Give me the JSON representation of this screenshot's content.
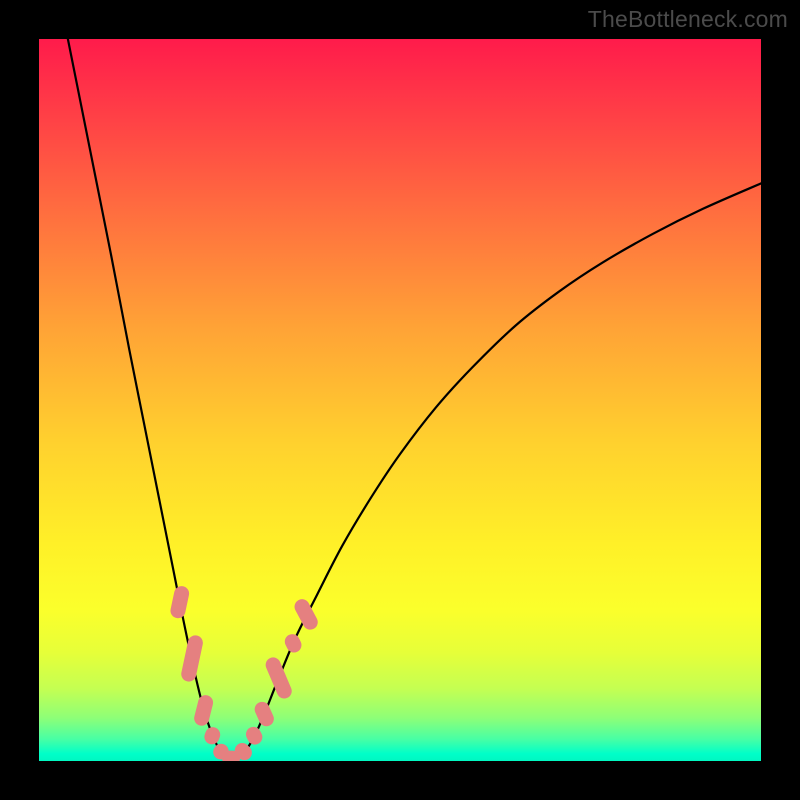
{
  "watermark": "TheBottleneck.com",
  "colors": {
    "frame": "#000000",
    "curve_stroke": "#000000",
    "bead_fill": "#e58080",
    "bead_stroke": "#d46a6a",
    "gradient_stops": [
      {
        "pct": 0,
        "hex": "#ff1b4b"
      },
      {
        "pct": 9,
        "hex": "#ff3a47"
      },
      {
        "pct": 24,
        "hex": "#ff6e3f"
      },
      {
        "pct": 40,
        "hex": "#ffa336"
      },
      {
        "pct": 56,
        "hex": "#ffd12e"
      },
      {
        "pct": 70,
        "hex": "#fff028"
      },
      {
        "pct": 79,
        "hex": "#fbff2b"
      },
      {
        "pct": 85,
        "hex": "#e6ff39"
      },
      {
        "pct": 90,
        "hex": "#c4ff52"
      },
      {
        "pct": 94,
        "hex": "#8eff77"
      },
      {
        "pct": 97,
        "hex": "#47ffa5"
      },
      {
        "pct": 99,
        "hex": "#00ffc9"
      },
      {
        "pct": 100,
        "hex": "#00f7c1"
      }
    ]
  },
  "chart_data": {
    "type": "line",
    "title": "",
    "xlabel": "",
    "ylabel": "",
    "xlim": [
      0,
      100
    ],
    "ylim": [
      0,
      100
    ],
    "curve_points": [
      {
        "x": 4.0,
        "y": 100.0
      },
      {
        "x": 6.0,
        "y": 90.0
      },
      {
        "x": 8.0,
        "y": 80.0
      },
      {
        "x": 10.0,
        "y": 70.0
      },
      {
        "x": 12.5,
        "y": 57.0
      },
      {
        "x": 14.5,
        "y": 47.0
      },
      {
        "x": 16.5,
        "y": 37.0
      },
      {
        "x": 18.5,
        "y": 27.0
      },
      {
        "x": 20.0,
        "y": 19.5
      },
      {
        "x": 21.5,
        "y": 12.5
      },
      {
        "x": 23.0,
        "y": 6.5
      },
      {
        "x": 24.5,
        "y": 2.5
      },
      {
        "x": 25.5,
        "y": 0.8
      },
      {
        "x": 26.5,
        "y": 0.3
      },
      {
        "x": 28.0,
        "y": 0.8
      },
      {
        "x": 29.5,
        "y": 2.8
      },
      {
        "x": 31.0,
        "y": 6.0
      },
      {
        "x": 33.0,
        "y": 11.0
      },
      {
        "x": 35.5,
        "y": 17.0
      },
      {
        "x": 38.5,
        "y": 23.0
      },
      {
        "x": 42.0,
        "y": 29.8
      },
      {
        "x": 46.0,
        "y": 36.5
      },
      {
        "x": 50.0,
        "y": 42.5
      },
      {
        "x": 55.0,
        "y": 49.0
      },
      {
        "x": 60.0,
        "y": 54.5
      },
      {
        "x": 66.0,
        "y": 60.3
      },
      {
        "x": 72.0,
        "y": 65.0
      },
      {
        "x": 78.0,
        "y": 69.0
      },
      {
        "x": 85.0,
        "y": 73.0
      },
      {
        "x": 92.0,
        "y": 76.5
      },
      {
        "x": 100.0,
        "y": 80.0
      }
    ],
    "beads_left": [
      {
        "x": 19.5,
        "y": 22.0,
        "len": 4.5,
        "angle": -78
      },
      {
        "x": 21.2,
        "y": 14.2,
        "len": 6.5,
        "angle": -78
      },
      {
        "x": 22.8,
        "y": 7.0,
        "len": 4.3,
        "angle": -76
      },
      {
        "x": 24.0,
        "y": 3.5,
        "len": 2.4,
        "angle": -70
      },
      {
        "x": 25.2,
        "y": 1.3,
        "len": 2.2,
        "angle": -55
      }
    ],
    "beads_bottom": [
      {
        "x": 26.6,
        "y": 0.4,
        "len": 2.5,
        "angle": 0
      },
      {
        "x": 28.3,
        "y": 1.3,
        "len": 2.5,
        "angle": 45
      }
    ],
    "beads_right": [
      {
        "x": 29.8,
        "y": 3.5,
        "len": 2.5,
        "angle": 63
      },
      {
        "x": 31.2,
        "y": 6.5,
        "len": 3.5,
        "angle": 66
      },
      {
        "x": 33.2,
        "y": 11.5,
        "len": 6.0,
        "angle": 67
      },
      {
        "x": 35.2,
        "y": 16.3,
        "len": 2.6,
        "angle": 64
      },
      {
        "x": 37.0,
        "y": 20.3,
        "len": 4.5,
        "angle": 62
      }
    ]
  }
}
